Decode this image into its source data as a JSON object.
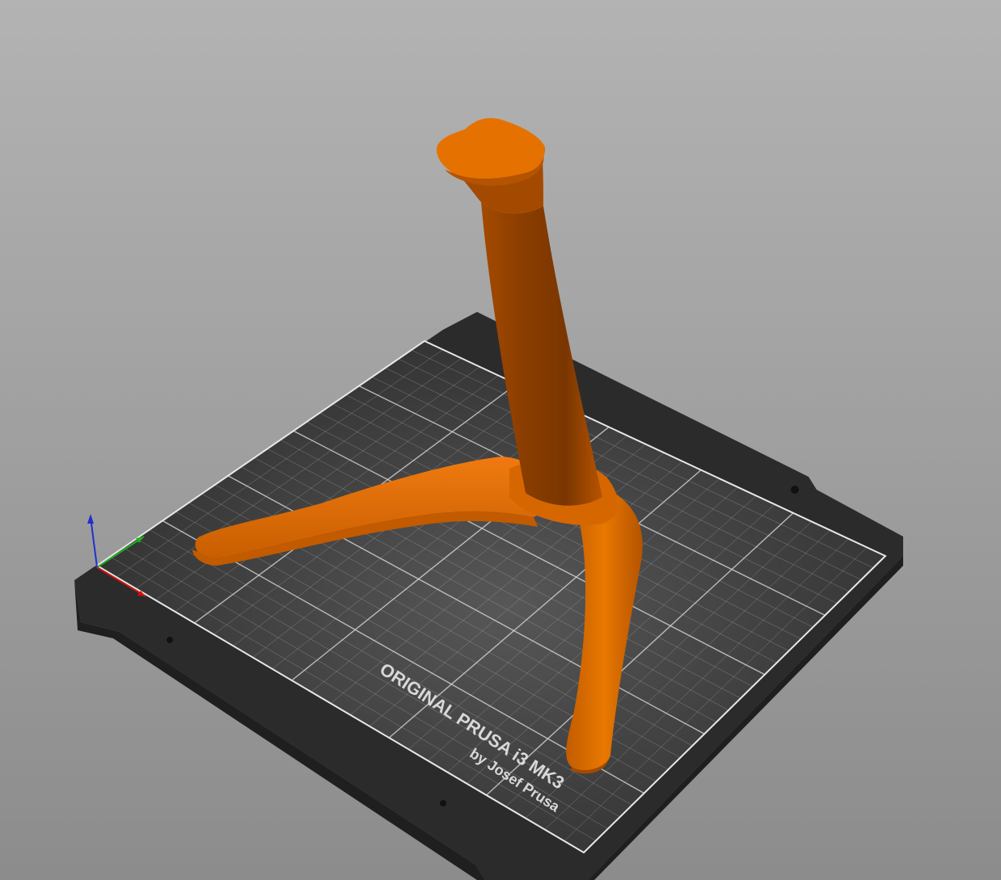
{
  "viewport": {
    "background_top": "#adadad",
    "background_bottom": "#8f8f8f"
  },
  "bed": {
    "brand_line": "ORIGINAL PRUSA i3  MK3",
    "author_line": "by Josef Prusa",
    "plate_color": "#2e2e2e",
    "grid_color": "#d8d8d8"
  },
  "model": {
    "color": "#e57200",
    "shadow_color": "#8a3f00"
  },
  "axes": {
    "x_color": "#d01010",
    "y_color": "#20b020",
    "z_color": "#2030d0"
  }
}
